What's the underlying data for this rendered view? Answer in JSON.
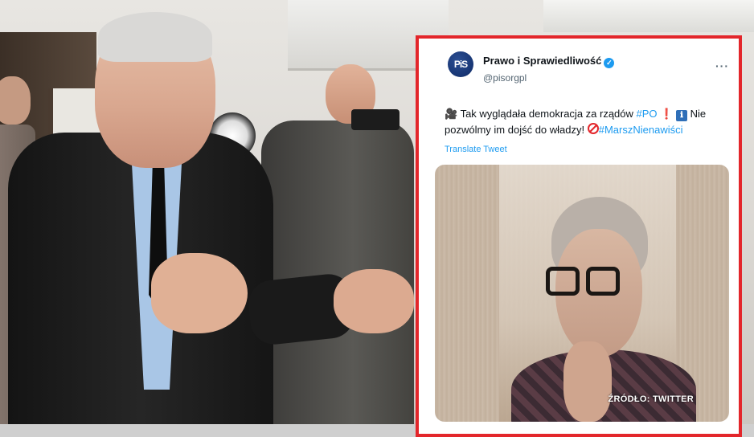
{
  "tweet": {
    "avatar_text": "PiS",
    "name": "Prawo i Sprawiedliwość",
    "handle": "@pisorgpl",
    "more_label": "···",
    "text_part1": "Tak wyglądała demokracja za rządów",
    "hashtag_po": "#PO",
    "exclamation": "❗",
    "info_symbol": "ℹ",
    "text_part2": "Nie pozwólmy im dojść do władzy!",
    "hashtag_marsz": "#MarszNienawiści",
    "translate_label": "Translate Tweet",
    "media_source_label": "ŹRÓDŁO: TWITTER"
  },
  "colors": {
    "frame_red": "#e3262b",
    "link_blue": "#1d9bf0",
    "pis_navy": "#0e2a66"
  },
  "icons": [
    "camera-icon",
    "verified-badge-icon",
    "more-icon",
    "exclamation-icon",
    "info-icon",
    "no-entry-icon"
  ]
}
